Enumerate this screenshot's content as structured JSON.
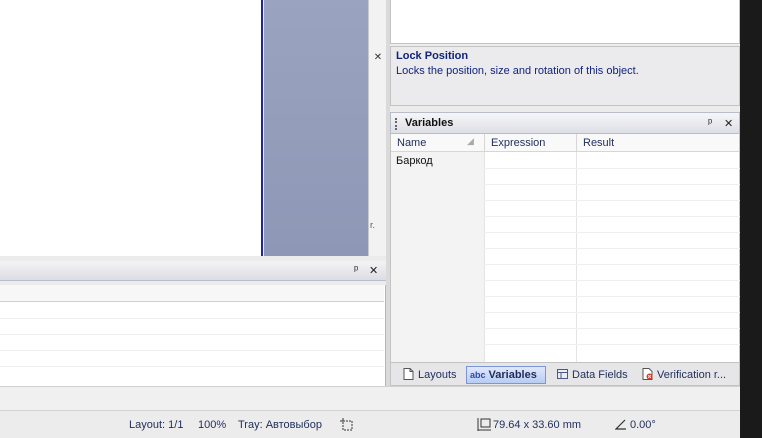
{
  "properties": {
    "description_title": "Lock Position",
    "description_text": "Locks the position, size and rotation of this object."
  },
  "variables_panel": {
    "title": "Variables",
    "pin_glyph": "ᵖ",
    "close_glyph": "✕",
    "columns": [
      "Name",
      "Expression",
      "Result"
    ],
    "rows": [
      {
        "name": "Баркод",
        "expression": "",
        "result": ""
      }
    ]
  },
  "lower_panel": {
    "pin_glyph": "ᵖ",
    "close_glyph": "✕"
  },
  "clipped_panel": {
    "close_glyph": "✕",
    "truncated_text": "r."
  },
  "tabs": [
    {
      "label": "Layouts",
      "icon": "page-icon"
    },
    {
      "label": "Variables",
      "icon": "abc-icon",
      "icon_text": "abc",
      "active": true
    },
    {
      "label": "Data Fields",
      "icon": "data-fields-icon"
    },
    {
      "label": "Verification r...",
      "icon": "verification-icon"
    }
  ],
  "statusbar": {
    "layout": "Layout: 1/1",
    "zoom": "100%",
    "tray": "Tray: Автовыбор",
    "size": "79.64 x 33.60 mm",
    "rotation": "0.00°",
    "size_icon": "dimensions-icon",
    "rotation_icon": "angle-icon",
    "selection_icon": "selection-icon"
  },
  "colors": {
    "accent": "#1e2a8a",
    "tab_active": "#b9ccf4",
    "text": "#1f2d5a"
  }
}
